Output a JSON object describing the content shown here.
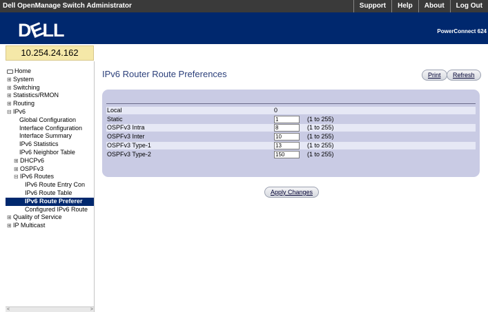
{
  "header": {
    "app_title": "Dell OpenManage Switch Administrator",
    "links": [
      "Support",
      "Help",
      "About",
      "Log Out"
    ],
    "logo_text": "DELL",
    "model": "PowerConnect 624"
  },
  "ip_address": "10.254.24.162",
  "sidebar": {
    "items": [
      {
        "label": "Home",
        "level": 0,
        "glyph": "home-icon",
        "sel": false
      },
      {
        "label": "System",
        "level": 0,
        "glyph": "plus",
        "sel": false
      },
      {
        "label": "Switching",
        "level": 0,
        "glyph": "plus",
        "sel": false
      },
      {
        "label": "Statistics/RMON",
        "level": 0,
        "glyph": "plus",
        "sel": false
      },
      {
        "label": "Routing",
        "level": 0,
        "glyph": "plus",
        "sel": false
      },
      {
        "label": "IPv6",
        "level": 0,
        "glyph": "minus",
        "sel": false
      },
      {
        "label": "Global Configuration",
        "level": 2,
        "glyph": "",
        "sel": false
      },
      {
        "label": "Interface Configuration",
        "level": 2,
        "glyph": "",
        "sel": false
      },
      {
        "label": "Interface Summary",
        "level": 2,
        "glyph": "",
        "sel": false
      },
      {
        "label": "IPv6 Statistics",
        "level": 2,
        "glyph": "",
        "sel": false
      },
      {
        "label": "IPv6 Neighbor Table",
        "level": 2,
        "glyph": "",
        "sel": false
      },
      {
        "label": "DHCPv6",
        "level": 1,
        "glyph": "plus",
        "sel": false
      },
      {
        "label": "OSPFv3",
        "level": 1,
        "glyph": "plus",
        "sel": false
      },
      {
        "label": "IPv6 Routes",
        "level": 1,
        "glyph": "minus",
        "sel": false
      },
      {
        "label": "IPv6 Route Entry Con",
        "level": 3,
        "glyph": "",
        "sel": false
      },
      {
        "label": "IPv6 Route Table",
        "level": 3,
        "glyph": "",
        "sel": false
      },
      {
        "label": "IPv6 Route Preferer",
        "level": 3,
        "glyph": "",
        "sel": true
      },
      {
        "label": "Configured IPv6 Route",
        "level": 3,
        "glyph": "",
        "sel": false
      },
      {
        "label": "Quality of Service",
        "level": 0,
        "glyph": "plus",
        "sel": false
      },
      {
        "label": "IP Multicast",
        "level": 0,
        "glyph": "plus",
        "sel": false
      }
    ],
    "scroll_left": "<",
    "scroll_right": ">"
  },
  "main": {
    "title": "IPv6 Router Route Preferences",
    "print_label": "Print",
    "refresh_label": "Refresh",
    "apply_label": "Apply Changes",
    "rows": [
      {
        "label": "Local",
        "value": "0",
        "editable": false,
        "range": ""
      },
      {
        "label": "Static",
        "value": "1",
        "editable": true,
        "range": "(1 to 255)"
      },
      {
        "label": "OSPFv3 Intra",
        "value": "8",
        "editable": true,
        "range": "(1 to 255)"
      },
      {
        "label": "OSPFv3 Inter",
        "value": "10",
        "editable": true,
        "range": "(1 to 255)"
      },
      {
        "label": "OSPFv3 Type-1",
        "value": "13",
        "editable": true,
        "range": "(1 to 255)"
      },
      {
        "label": "OSPFv3 Type-2",
        "value": "150",
        "editable": true,
        "range": "(1 to 255)"
      }
    ]
  },
  "colors": {
    "brand_blue": "#00286e",
    "panel": "#c9cbe4",
    "selected": "#00286e",
    "ip_box": "#f5e8a8"
  }
}
